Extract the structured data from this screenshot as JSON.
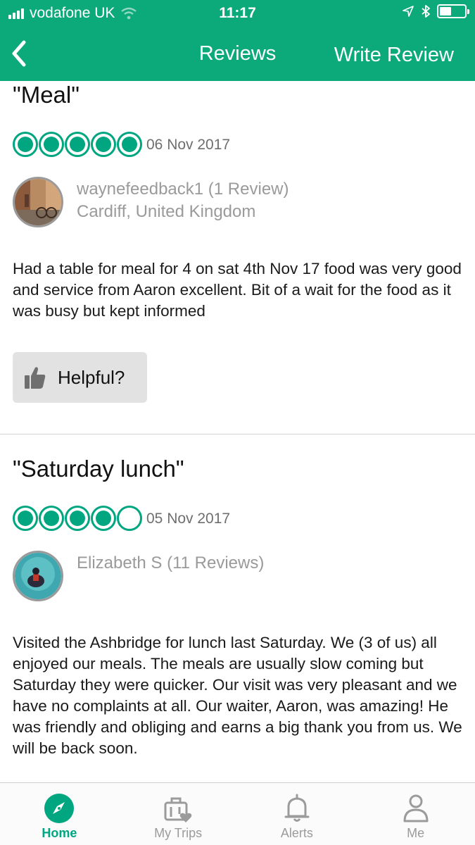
{
  "status": {
    "carrier": "vodafone UK",
    "time": "11:17"
  },
  "nav": {
    "title": "Reviews",
    "write_review": "Write Review"
  },
  "reviews": [
    {
      "title": "\"Meal\"",
      "rating": 5,
      "date": "06 Nov 2017",
      "user_line": "waynefeedback1 (1 Review)",
      "location": "Cardiff, United Kingdom",
      "text": "Had a table for meal for 4 on sat 4th Nov 17  food was very good and service from Aaron excellent. Bit of a wait for the food as it was busy but kept informed",
      "helpful": "Helpful?"
    },
    {
      "title": "\"Saturday lunch\"",
      "rating": 4,
      "date": "05 Nov 2017",
      "user_line": "Elizabeth S (11 Reviews)",
      "text": "Visited the Ashbridge for lunch last Saturday.  We (3 of us) all enjoyed our meals. The meals are usually slow coming but Saturday they were quicker.  Our visit was very pleasant and we have no complaints at all.  Our waiter, Aaron, was amazing!  He was friendly and obliging and earns a big thank you from us.  We will be back soon."
    }
  ],
  "tabs": [
    {
      "label": "Home",
      "icon": "compass-icon",
      "active": true
    },
    {
      "label": "My Trips",
      "icon": "suitcase-heart-icon",
      "active": false
    },
    {
      "label": "Alerts",
      "icon": "bell-icon",
      "active": false
    },
    {
      "label": "Me",
      "icon": "person-icon",
      "active": false
    }
  ],
  "colors": {
    "brand": "#0ca97b",
    "bubble": "#00a680"
  }
}
